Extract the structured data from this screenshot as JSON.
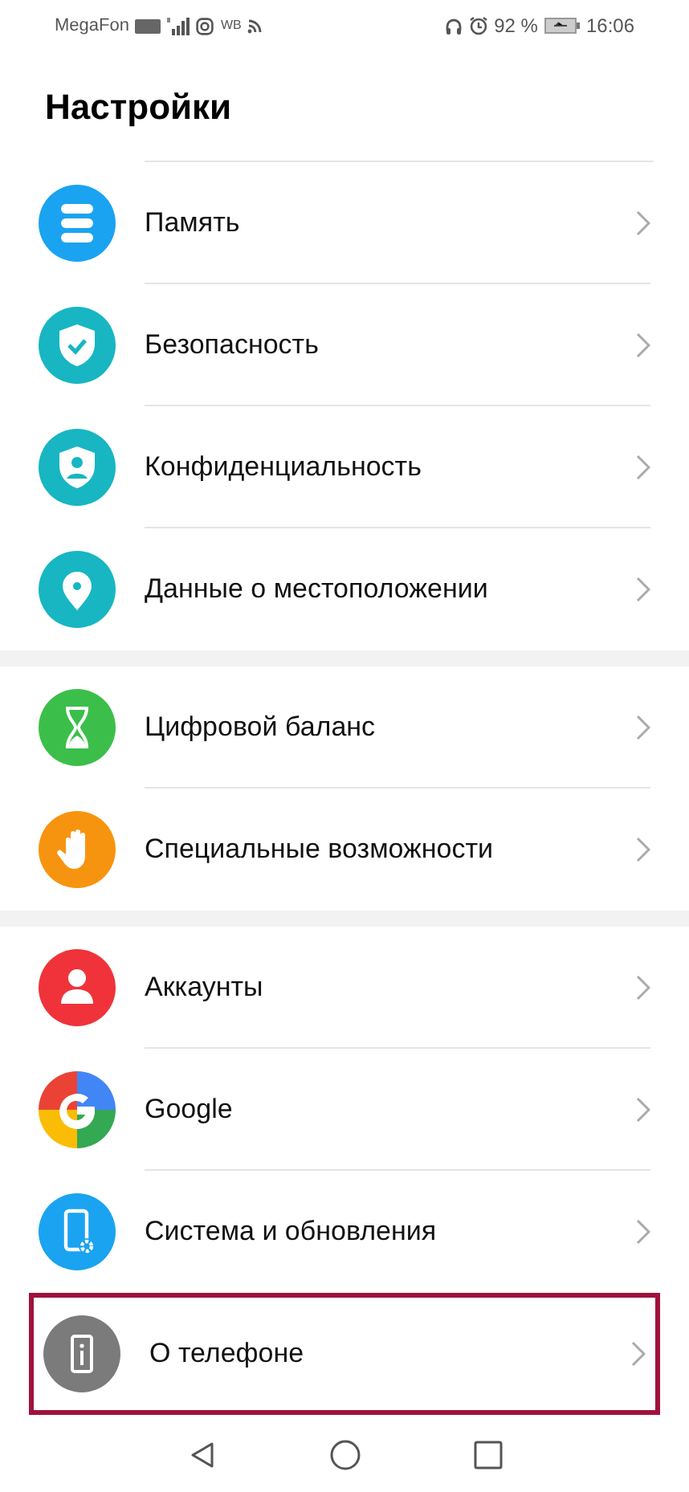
{
  "status_bar": {
    "carrier": "MegaFon",
    "extra": "WB",
    "battery": "92 %",
    "time": "16:06"
  },
  "title": "Настройки",
  "groups": [
    {
      "items": [
        {
          "label": "Память",
          "kind": "storage",
          "color": "#1aa3f0",
          "highlighted": false
        },
        {
          "label": "Безопасность",
          "kind": "shield-check",
          "color": "#17b6c2",
          "highlighted": false
        },
        {
          "label": "Конфиденциальность",
          "kind": "shield-person",
          "color": "#17b6c2",
          "highlighted": false
        },
        {
          "label": "Данные о местоположении",
          "kind": "pin",
          "color": "#17b6c2",
          "highlighted": false
        }
      ]
    },
    {
      "items": [
        {
          "label": "Цифровой баланс",
          "kind": "hourglass",
          "color": "#3bbf4a",
          "highlighted": false
        },
        {
          "label": "Специальные возможности",
          "kind": "hand",
          "color": "#f7940f",
          "highlighted": false
        }
      ]
    },
    {
      "items": [
        {
          "label": "Аккаунты",
          "kind": "person",
          "color": "#f0333a",
          "highlighted": false
        },
        {
          "label": "Google",
          "kind": "google",
          "highlighted": false
        },
        {
          "label": "Система и обновления",
          "kind": "phone-gear",
          "color": "#1aa3f0",
          "highlighted": false
        },
        {
          "label": "О телефоне",
          "kind": "phone-info",
          "color": "#7b7b7b",
          "highlighted": true
        }
      ]
    }
  ]
}
